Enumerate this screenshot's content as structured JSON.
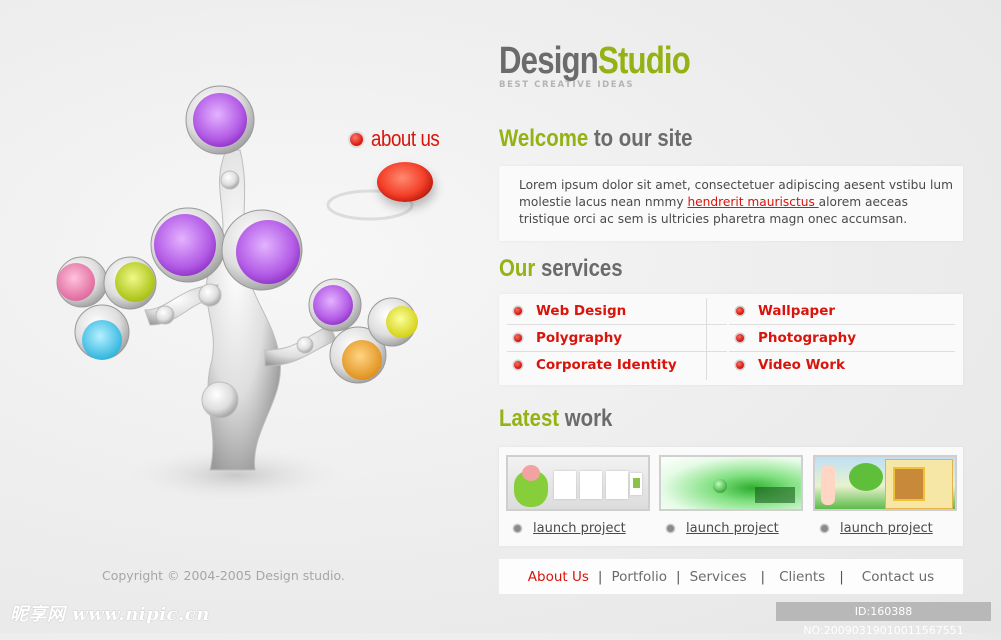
{
  "logo": {
    "part1": "Design",
    "part2": "Studio",
    "tagline": "BEST CREATIVE IDEAS"
  },
  "about_link": {
    "label": "about us"
  },
  "welcome": {
    "title_highlight": "Welcome",
    "title_rest": " to our site",
    "text_before": "Lorem ipsum dolor sit amet, consectetuer adipiscing  aesent vstibu lum molestie lacus nean nmmy ",
    "link": "hendrerit maurisctus ",
    "text_after": "alorem aeceas tristique orci ac sem is ultricies pharetra magn onec accumsan."
  },
  "services": {
    "title_highlight": "Our",
    "title_rest": " services",
    "left": [
      "Web Design",
      "Polygraphy",
      "Corporate Identity"
    ],
    "right": [
      "Wallpaper",
      "Photography",
      "Video Work"
    ]
  },
  "latest": {
    "title_highlight": "Latest",
    "title_rest": " work",
    "items": [
      {
        "launch": "launch project",
        "thumb": "project-thumbnail-1"
      },
      {
        "launch": "launch project",
        "thumb": "project-thumbnail-2"
      },
      {
        "launch": "launch project",
        "thumb": "project-thumbnail-3"
      }
    ]
  },
  "footer_nav": [
    "About Us",
    "Portfolio",
    "Services",
    "Clients",
    "Contact us"
  ],
  "copyright": "Copyright © 2004-2005 Design studio.",
  "watermark": "昵享网 www.nipic.cn",
  "id_badge": "ID:160388 NO:20090319010011567551",
  "colors": {
    "accent_red": "#d8140b",
    "accent_green": "#94b213",
    "heading_grey": "#6b6b6b"
  }
}
